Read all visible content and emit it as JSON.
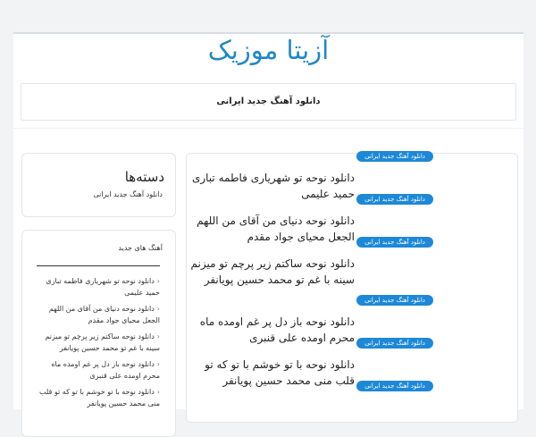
{
  "site": {
    "title": "آزیتا موزیک"
  },
  "nav": {
    "items": [
      "دانلود آهنگ جدید ایرانی"
    ]
  },
  "posts": [
    {
      "badge": "دانلود آهنگ جدید ایرانی",
      "title": "دانلود نوحه تو شهریاری فاطمه تباری حمید علیمی"
    },
    {
      "badge": "دانلود آهنگ جدید ایرانی",
      "title": "دانلود نوحه دنیای من آقای من اللهم الجعل محیای جواد مقدم"
    },
    {
      "badge": "دانلود آهنگ جدید ایرانی",
      "title": "دانلود نوحه ساکتم زیر پرچم تو میزنم سینه با غم تو محمد حسین پویانفر"
    },
    {
      "badge": "دانلود آهنگ جدید ایرانی",
      "title": "دانلود نوحه باز دل پر غم اومده ماه محرم اومده علی قنبری"
    },
    {
      "badge": "دانلود آهنگ جدید ایرانی",
      "title": "دانلود نوحه با تو خوشم با تو که تو قلب منی محمد حسین پویانفر"
    },
    {
      "badge": "دانلود آهنگ جدید ایرانی",
      "title": ""
    }
  ],
  "sidebar": {
    "categories": {
      "title": "دسته‌ها",
      "items": [
        "دانلود آهنگ جدید ایرانی"
      ]
    },
    "songs": {
      "title": "آهنگ های جدید",
      "items": [
        "دانلود نوحه تو شهریاری فاطمه تباری حمید علیمی",
        "دانلود نوحه دنیای من آقای من اللهم الجعل محیای جواد مقدم",
        "دانلود نوحه ساکتم زیر پرچم تو میزنم سینه با غم تو محمد حسین پویانفر",
        "دانلود نوحه باز دل پر غم اومده ماه محرم اومده علی قنبری",
        "دانلود نوحه با تو خوشم با تو که تو قلب منی محمد حسین پویانفر"
      ]
    }
  }
}
